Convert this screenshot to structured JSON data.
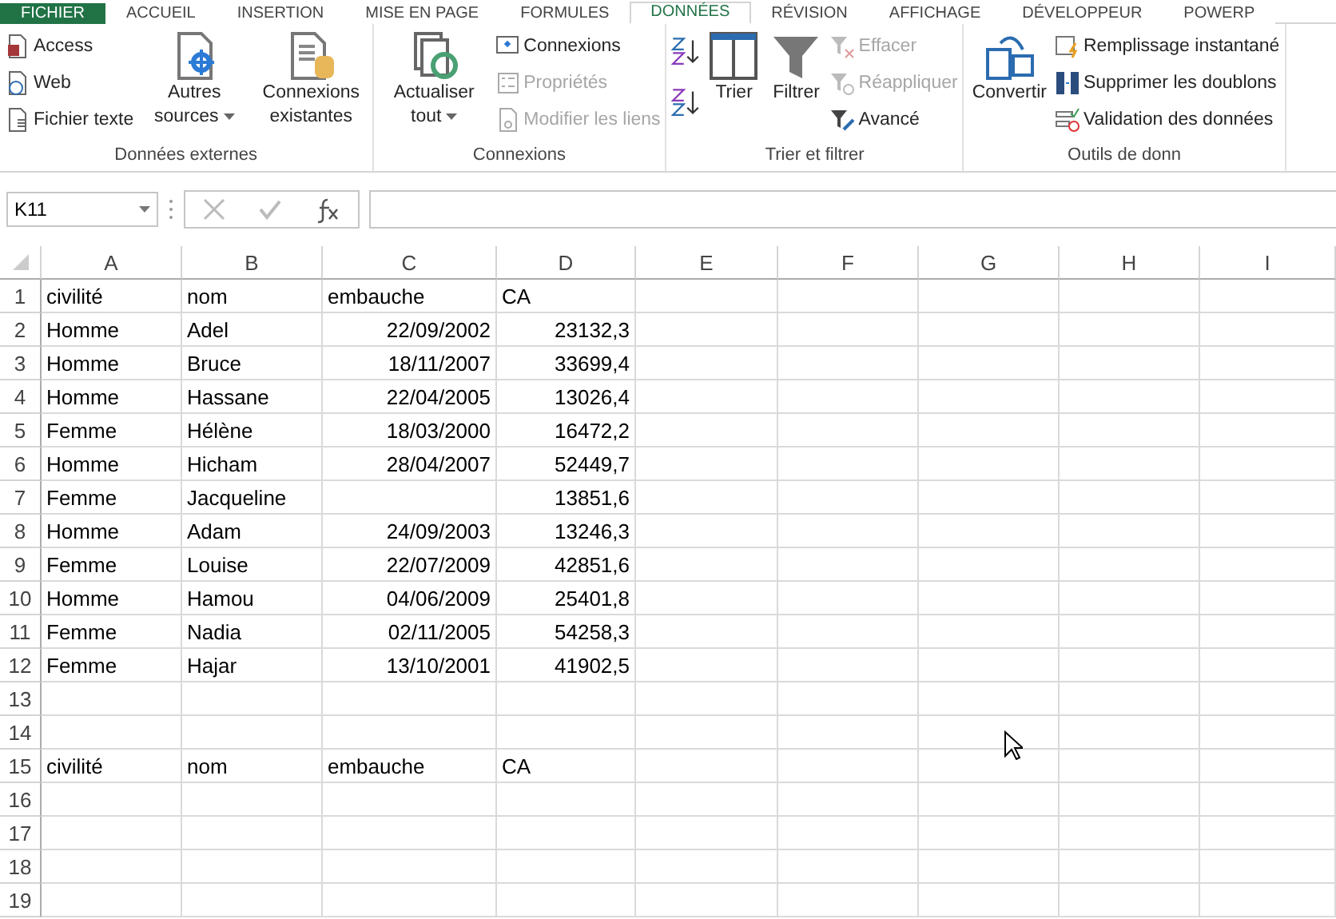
{
  "ribbon": {
    "tabs": [
      {
        "label": "FICHIER",
        "selected": false,
        "kind": "file"
      },
      {
        "label": "ACCUEIL",
        "selected": false,
        "kind": "tab"
      },
      {
        "label": "INSERTION",
        "selected": false,
        "kind": "tab"
      },
      {
        "label": "MISE EN PAGE",
        "selected": false,
        "kind": "tab"
      },
      {
        "label": "FORMULES",
        "selected": false,
        "kind": "tab"
      },
      {
        "label": "DONNÉES",
        "selected": true,
        "kind": "tab"
      },
      {
        "label": "RÉVISION",
        "selected": false,
        "kind": "tab"
      },
      {
        "label": "AFFICHAGE",
        "selected": false,
        "kind": "tab"
      },
      {
        "label": "DÉVELOPPEUR",
        "selected": false,
        "kind": "tab"
      },
      {
        "label": "POWERP",
        "selected": false,
        "kind": "tab"
      }
    ],
    "groups": [
      {
        "label": "Données externes",
        "items": [
          {
            "kind": "stack",
            "buttons": [
              {
                "label": "Access",
                "disabled": false
              },
              {
                "label": "Web",
                "disabled": false
              },
              {
                "label": "Fichier texte",
                "disabled": false
              }
            ]
          },
          {
            "kind": "large",
            "label": "Autres sources",
            "dropdown": true,
            "disabled": false
          },
          {
            "kind": "large",
            "label": "Connexions existantes",
            "dropdown": false,
            "disabled": false
          }
        ]
      },
      {
        "label": "Connexions",
        "items": [
          {
            "kind": "large",
            "label": "Actualiser tout",
            "dropdown": true,
            "disabled": false
          },
          {
            "kind": "stack",
            "buttons": [
              {
                "label": "Connexions",
                "disabled": false
              },
              {
                "label": "Propriétés",
                "disabled": true
              },
              {
                "label": "Modifier les liens",
                "disabled": true
              }
            ]
          }
        ]
      },
      {
        "label": "Trier et filtrer",
        "items": [
          {
            "kind": "sortpair"
          },
          {
            "kind": "large",
            "label": "Trier",
            "dropdown": false,
            "disabled": false
          },
          {
            "kind": "large",
            "label": "Filtrer",
            "dropdown": false,
            "disabled": false
          },
          {
            "kind": "stack",
            "buttons": [
              {
                "label": "Effacer",
                "disabled": true
              },
              {
                "label": "Réappliquer",
                "disabled": true
              },
              {
                "label": "Avancé",
                "disabled": false
              }
            ]
          }
        ]
      },
      {
        "label": "Outils de donn",
        "items": [
          {
            "kind": "large",
            "label": "Convertir",
            "dropdown": false,
            "disabled": false
          },
          {
            "kind": "stack",
            "buttons": [
              {
                "label": "Remplissage instantané",
                "disabled": false
              },
              {
                "label": "Supprimer les doublons",
                "disabled": false
              },
              {
                "label": "Validation des données",
                "disabled": false
              }
            ]
          }
        ]
      }
    ]
  },
  "formula_bar": {
    "name_box": "K11"
  },
  "sheet": {
    "columns": [
      "A",
      "B",
      "C",
      "D",
      "E",
      "F",
      "G",
      "H",
      "I"
    ],
    "rows": [
      {
        "number": "1",
        "cells": [
          {
            "value": "civilité",
            "kind": "text"
          },
          {
            "value": "nom",
            "kind": "text"
          },
          {
            "value": "embauche",
            "kind": "text"
          },
          {
            "value": "CA",
            "kind": "text"
          }
        ]
      },
      {
        "number": "2",
        "cells": [
          {
            "value": "Homme",
            "kind": "text"
          },
          {
            "value": "Adel",
            "kind": "text"
          },
          {
            "value": "22/09/2002",
            "kind": "number"
          },
          {
            "value": "23132,3",
            "kind": "number"
          }
        ]
      },
      {
        "number": "3",
        "cells": [
          {
            "value": "Homme",
            "kind": "text"
          },
          {
            "value": "Bruce",
            "kind": "text"
          },
          {
            "value": "18/11/2007",
            "kind": "number"
          },
          {
            "value": "33699,4",
            "kind": "number"
          }
        ]
      },
      {
        "number": "4",
        "cells": [
          {
            "value": "Homme",
            "kind": "text"
          },
          {
            "value": "Hassane",
            "kind": "text"
          },
          {
            "value": "22/04/2005",
            "kind": "number"
          },
          {
            "value": "13026,4",
            "kind": "number"
          }
        ]
      },
      {
        "number": "5",
        "cells": [
          {
            "value": "Femme",
            "kind": "text"
          },
          {
            "value": "Hélène",
            "kind": "text"
          },
          {
            "value": "18/03/2000",
            "kind": "number"
          },
          {
            "value": "16472,2",
            "kind": "number"
          }
        ]
      },
      {
        "number": "6",
        "cells": [
          {
            "value": "Homme",
            "kind": "text"
          },
          {
            "value": "Hicham",
            "kind": "text"
          },
          {
            "value": "28/04/2007",
            "kind": "number"
          },
          {
            "value": "52449,7",
            "kind": "number"
          }
        ]
      },
      {
        "number": "7",
        "cells": [
          {
            "value": "Femme",
            "kind": "text"
          },
          {
            "value": "Jacqueline",
            "kind": "text"
          },
          null,
          {
            "value": "13851,6",
            "kind": "number"
          }
        ]
      },
      {
        "number": "8",
        "cells": [
          {
            "value": "Homme",
            "kind": "text"
          },
          {
            "value": "Adam",
            "kind": "text"
          },
          {
            "value": "24/09/2003",
            "kind": "number"
          },
          {
            "value": "13246,3",
            "kind": "number"
          }
        ]
      },
      {
        "number": "9",
        "cells": [
          {
            "value": "Femme",
            "kind": "text"
          },
          {
            "value": "Louise",
            "kind": "text"
          },
          {
            "value": "22/07/2009",
            "kind": "number"
          },
          {
            "value": "42851,6",
            "kind": "number"
          }
        ]
      },
      {
        "number": "10",
        "cells": [
          {
            "value": "Homme",
            "kind": "text"
          },
          {
            "value": "Hamou",
            "kind": "text"
          },
          {
            "value": "04/06/2009",
            "kind": "number"
          },
          {
            "value": "25401,8",
            "kind": "number"
          }
        ]
      },
      {
        "number": "11",
        "cells": [
          {
            "value": "Femme",
            "kind": "text"
          },
          {
            "value": "Nadia",
            "kind": "text"
          },
          {
            "value": "02/11/2005",
            "kind": "number"
          },
          {
            "value": "54258,3",
            "kind": "number"
          }
        ]
      },
      {
        "number": "12",
        "cells": [
          {
            "value": "Femme",
            "kind": "text"
          },
          {
            "value": "Hajar",
            "kind": "text"
          },
          {
            "value": "13/10/2001",
            "kind": "number"
          },
          {
            "value": "41902,5",
            "kind": "number"
          }
        ]
      },
      {
        "number": "13",
        "cells": []
      },
      {
        "number": "14",
        "cells": []
      },
      {
        "number": "15",
        "cells": [
          {
            "value": "civilité",
            "kind": "text"
          },
          {
            "value": "nom",
            "kind": "text"
          },
          {
            "value": "embauche",
            "kind": "text"
          },
          {
            "value": "CA",
            "kind": "text"
          }
        ]
      },
      {
        "number": "16",
        "cells": []
      },
      {
        "number": "17",
        "cells": []
      },
      {
        "number": "18",
        "cells": []
      },
      {
        "number": "19",
        "cells": []
      }
    ]
  }
}
